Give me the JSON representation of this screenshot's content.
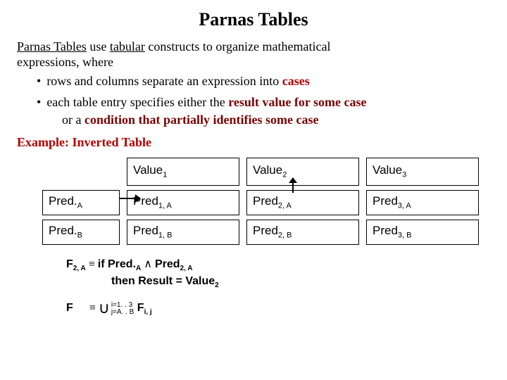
{
  "title": "Parnas Tables",
  "intro": {
    "lead1a": "Parnas Tables",
    "lead1b": " use ",
    "lead1c": "tabular",
    "lead1d": " constructs to organize mathematical",
    "lead2": "expressions, where"
  },
  "bullets": {
    "b1a": "rows and columns separate an expression into ",
    "b1b": "cases",
    "b2a": "each table entry specifies either the ",
    "b2b": "result value for some case",
    "b2c": "or a ",
    "b2d": "condition that partially identifies some case"
  },
  "example_label": "Example: Inverted Table",
  "table": {
    "headers": {
      "v1": "Value",
      "v1s": "1",
      "v2": "Value",
      "v2s": "2",
      "v3": "Value",
      "v3s": "3"
    },
    "rowlabels": {
      "ra": "Pred.",
      "ras": "A",
      "rb": "Pred.",
      "rbs": "B"
    },
    "cells": {
      "c1a": "Pred",
      "c1as": "1, A",
      "c2a": "Pred",
      "c2as": "2, A",
      "c3a": "Pred",
      "c3as": "3, A",
      "c1b": "Pred",
      "c1bs": "1, B",
      "c2b": "Pred",
      "c2bs": "2, B",
      "c3b": "Pred",
      "c3bs": "3, B"
    }
  },
  "formula": {
    "f_lhs": "F",
    "f_lhs_sub": "2, A",
    "equiv": " ≡ ",
    "if": "if Pred.",
    "if_sub": "A",
    "and": " ∧ ",
    "pred2": "Pred",
    "pred2_sub": "2, A",
    "then": "then Result = Value",
    "then_sub": "2",
    "f2_lhs": "F",
    "cup": "∪",
    "cup_sub1": "i=1. . 3",
    "cup_sub2": "j=A. . B",
    "fij": " F",
    "fij_sub": "i, j"
  }
}
